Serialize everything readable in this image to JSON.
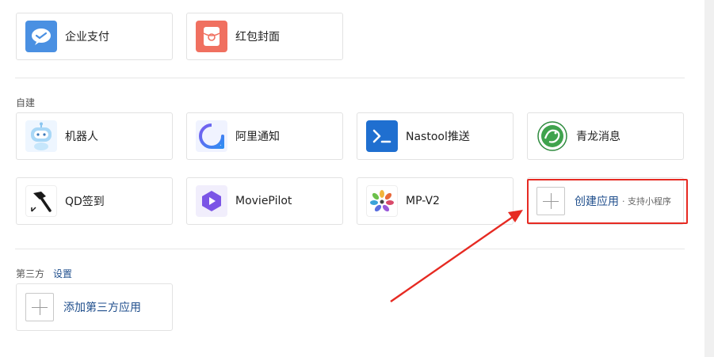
{
  "top_apps": [
    {
      "label": "企业支付",
      "icon": "enterprise-pay-icon",
      "color": "#4a90e2"
    },
    {
      "label": "红包封面",
      "icon": "red-packet-icon",
      "color": "#f07060"
    }
  ],
  "self_built": {
    "title": "自建",
    "apps": [
      {
        "label": "机器人",
        "icon": "robot-icon"
      },
      {
        "label": "阿里通知",
        "icon": "ali-notify-icon"
      },
      {
        "label": "Nastool推送",
        "icon": "nastool-icon",
        "color": "#1f6fd0"
      },
      {
        "label": "青龙消息",
        "icon": "qinglong-icon"
      },
      {
        "label": "QD签到",
        "icon": "qd-hammer-icon"
      },
      {
        "label": "MoviePilot",
        "icon": "moviepilot-icon"
      },
      {
        "label": "MP-V2",
        "icon": "mpv2-icon"
      }
    ],
    "create": {
      "label": "创建应用",
      "sub": "· 支持小程序"
    }
  },
  "third_party": {
    "title": "第三方",
    "settings_link": "设置",
    "add_label": "添加第三方应用"
  },
  "annotation": {
    "highlight_color": "#e62a22"
  }
}
